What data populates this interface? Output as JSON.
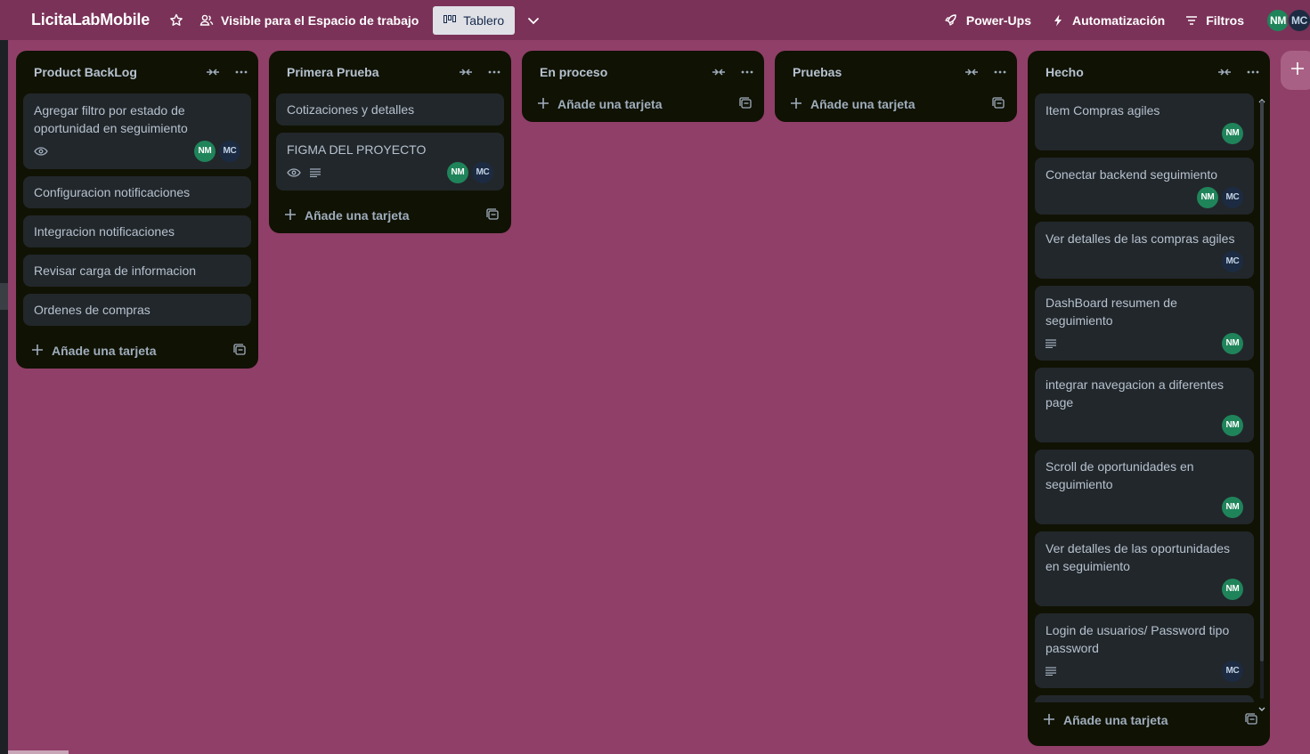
{
  "header": {
    "board_name": "LicitaLabMobile",
    "visibility_label": "Visible para el Espacio de trabajo",
    "view_tab_label": "Tablero",
    "powerups_label": "Power-Ups",
    "automation_label": "Automatización",
    "filters_label": "Filtros",
    "members": [
      "NM",
      "MC"
    ]
  },
  "colors": {
    "board_bg": "#903f68",
    "header_bg": "#7a3258",
    "list_bg": "#101204",
    "card_bg": "#22272b",
    "nm_avatar": "#1f845a",
    "mc_avatar": "#1c2b41"
  },
  "add_card_label": "Añade una tarjeta",
  "lists": [
    {
      "title": "Product BackLog",
      "cards": [
        {
          "title": "Agregar filtro por estado de oportunidad en seguimiento",
          "watch": true,
          "desc": false,
          "members": [
            "NM",
            "MC"
          ]
        },
        {
          "title": "Configuracion notificaciones"
        },
        {
          "title": "Integracion notificaciones"
        },
        {
          "title": "Revisar carga de informacion"
        },
        {
          "title": "Ordenes de compras"
        }
      ]
    },
    {
      "title": "Primera Prueba",
      "cards": [
        {
          "title": "Cotizaciones y detalles"
        },
        {
          "title": "FIGMA DEL PROYECTO",
          "watch": true,
          "desc": true,
          "members": [
            "NM",
            "MC"
          ]
        }
      ]
    },
    {
      "title": "En proceso",
      "cards": []
    },
    {
      "title": "Pruebas",
      "cards": []
    },
    {
      "title": "Hecho",
      "cards": [
        {
          "title": "Item Compras agiles",
          "members": [
            "NM"
          ]
        },
        {
          "title": "Conectar backend seguimiento",
          "members": [
            "NM",
            "MC"
          ]
        },
        {
          "title": "Ver detalles de las compras agiles",
          "members": [
            "MC"
          ]
        },
        {
          "title": "DashBoard resumen de seguimiento",
          "desc": true,
          "members": [
            "NM"
          ]
        },
        {
          "title": "integrar navegacion a diferentes page",
          "members": [
            "NM"
          ]
        },
        {
          "title": "Scroll de oportunidades en seguimiento",
          "members": [
            "NM"
          ]
        },
        {
          "title": "Ver detalles de las oportunidades en seguimiento",
          "members": [
            "NM"
          ]
        },
        {
          "title": "Login de usuarios/ Password tipo password",
          "desc": true,
          "members": [
            "MC"
          ]
        }
      ]
    }
  ]
}
